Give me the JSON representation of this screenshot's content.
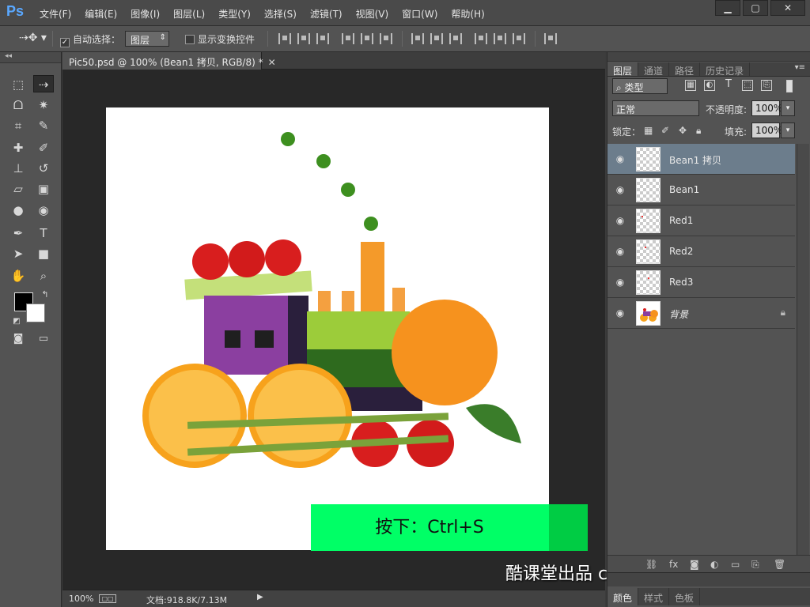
{
  "app": {
    "logo": "Ps",
    "menu": [
      "文件(F)",
      "编辑(E)",
      "图像(I)",
      "图层(L)",
      "类型(Y)",
      "选择(S)",
      "滤镜(T)",
      "视图(V)",
      "窗口(W)",
      "帮助(H)"
    ],
    "window_controls": [
      "minimize-icon",
      "maximize-icon",
      "close-icon"
    ]
  },
  "options": {
    "auto_select_label": "自动选择：",
    "auto_select_checked": true,
    "auto_select_target": "图层",
    "show_transform_label": "显示变换控件",
    "show_transform_checked": false
  },
  "document": {
    "tab_title": "Pic50.psd @ 100% (Bean1 拷贝, RGB/8) *",
    "banner_text": "按下：Ctrl+S",
    "watermark": "酷课堂出品 coolketang.com"
  },
  "status": {
    "zoom": "100%",
    "doc_size": "文档:918.8K/7.13M"
  },
  "panel": {
    "tabs": [
      "图层",
      "通道",
      "路径",
      "历史记录"
    ],
    "active_tab": "图层",
    "filter_kind": "类型",
    "blend_mode": "正常",
    "opacity_label": "不透明度:",
    "opacity_value": "100%",
    "lock_label": "锁定：",
    "fill_label": "填充:",
    "fill_value": "100%",
    "layers": [
      {
        "name": "Bean1 拷贝",
        "selected": true,
        "visible": true
      },
      {
        "name": "Bean1",
        "selected": false,
        "visible": true
      },
      {
        "name": "Red1",
        "selected": false,
        "visible": true
      },
      {
        "name": "Red2",
        "selected": false,
        "visible": true
      },
      {
        "name": "Red3",
        "selected": false,
        "visible": true
      },
      {
        "name": "背景",
        "selected": false,
        "visible": true,
        "locked": true
      }
    ]
  },
  "panel2": {
    "tabs": [
      "颜色",
      "样式",
      "色板"
    ]
  },
  "colors": {
    "banner": "#00ff66",
    "selected_layer": "#6c7d8c",
    "logo": "#5aa8ff"
  }
}
